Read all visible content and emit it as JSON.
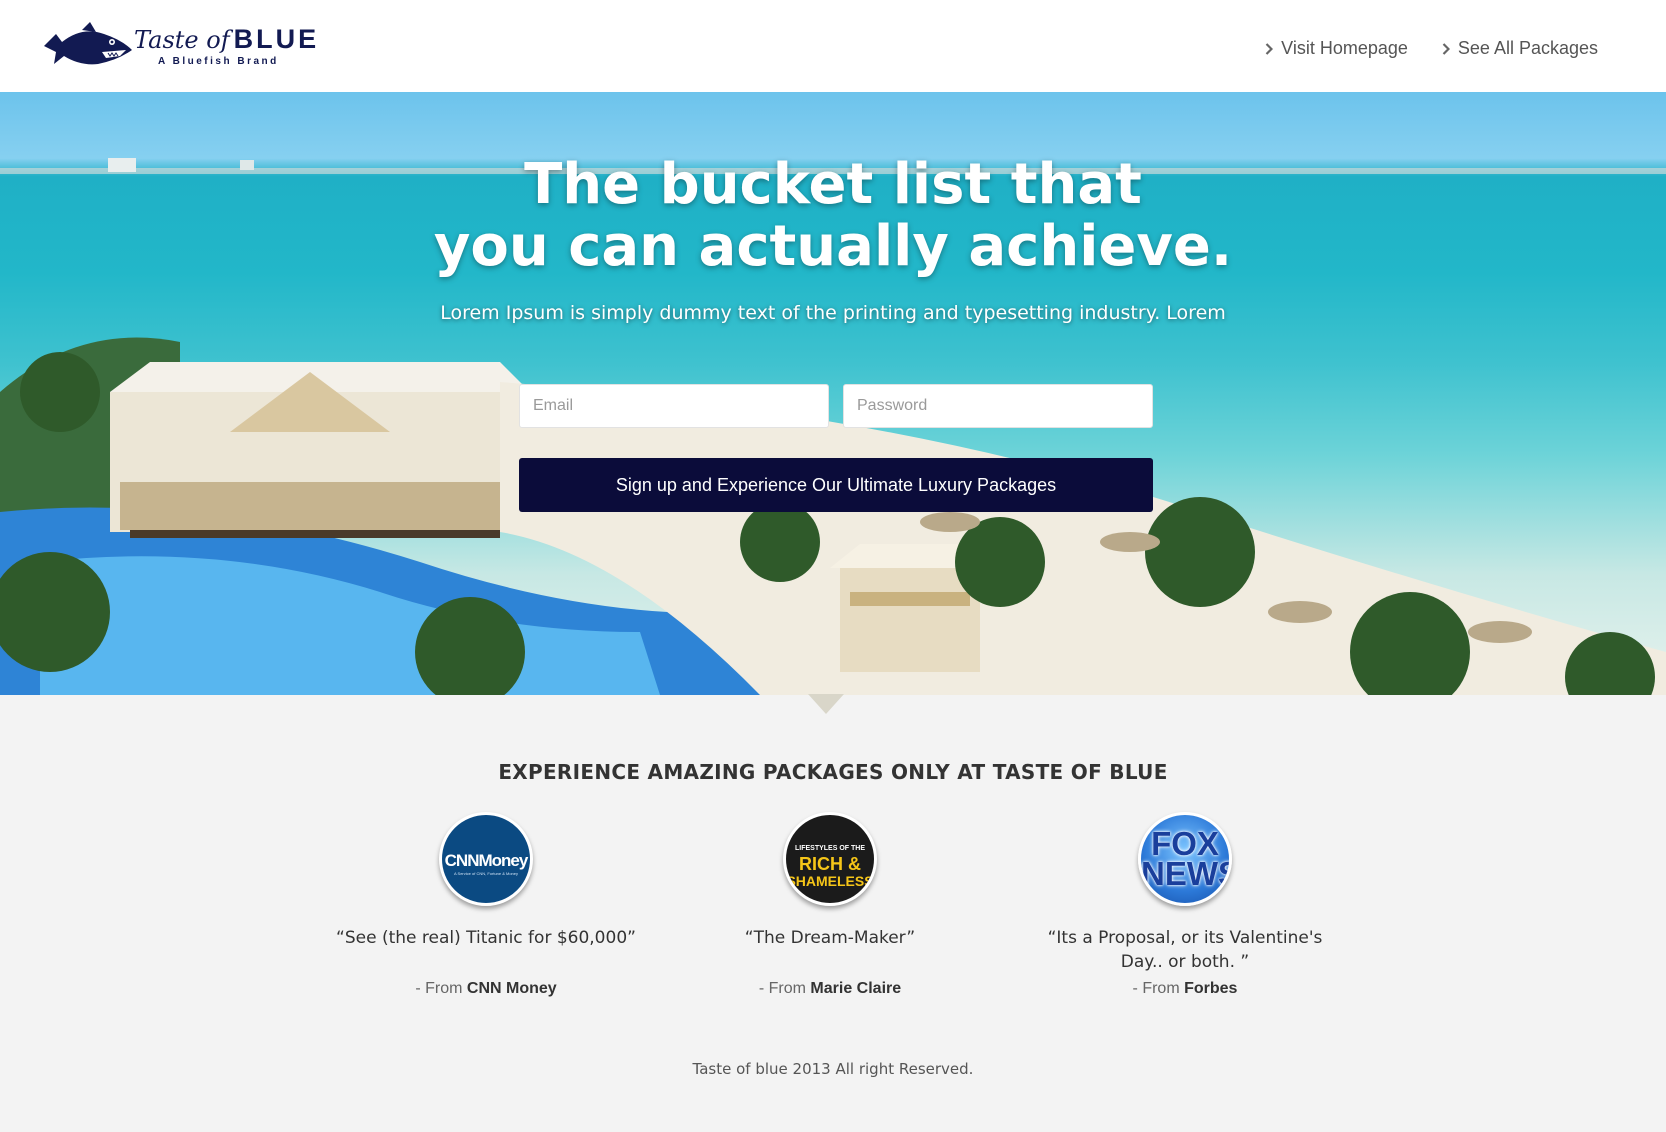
{
  "header": {
    "logo_script": "Taste of",
    "logo_word": "BLUE",
    "logo_tagline": "A Bluefish Brand",
    "nav": [
      {
        "label": "Visit Homepage"
      },
      {
        "label": "See All Packages"
      }
    ]
  },
  "hero": {
    "title_line1": "The bucket list that",
    "title_line2": "you can actually achieve.",
    "subtitle": "Lorem Ipsum is simply dummy text of the printing and typesetting industry. Lorem",
    "email_placeholder": "Email",
    "password_placeholder": "Password",
    "cta_label": "Sign up and Experience Our Ultimate Luxury Packages"
  },
  "press": {
    "title": "EXPERIENCE AMAZING PACKAGES ONLY AT TASTE OF BLUE",
    "from_prefix": "- From",
    "items": [
      {
        "logo_text": "CNNMoney",
        "logo_subtext": "A Service of CNN, Fortune & Money",
        "quote": "“See (the real) Titanic for $60,000”",
        "source": "CNN Money"
      },
      {
        "logo_text_top": "LIFESTYLES OF THE",
        "logo_text_mid": "RICH &",
        "logo_text_bot": "SHAMELESS",
        "quote": "“The Dream-Maker”",
        "source": "Marie Claire"
      },
      {
        "logo_text": "FOX NEWS",
        "quote": "“Its a Proposal, or its Valentine's Day.. or both. ”",
        "source": "Forbes"
      }
    ]
  },
  "footer": {
    "copyright": "Taste of blue 2013 All right Reserved."
  },
  "colors": {
    "brand_navy": "#121a52",
    "cta_background": "#0b0c3a",
    "page_background": "#f3f3f3"
  },
  "icons": [
    "bluefish-logo-icon",
    "chevron-right-icon"
  ]
}
